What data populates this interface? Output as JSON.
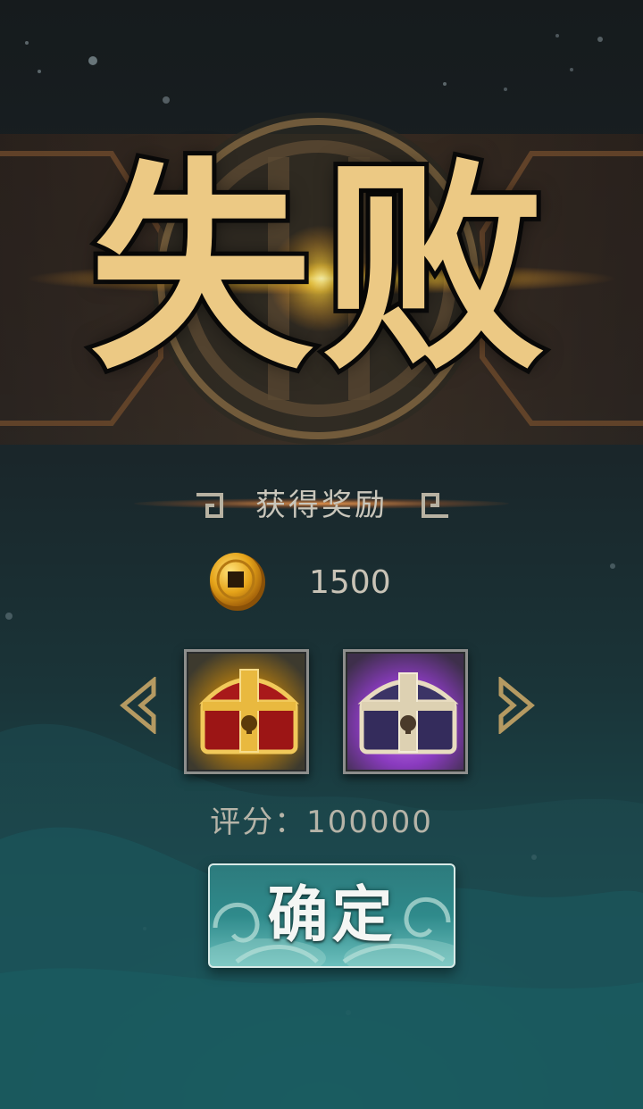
{
  "result": {
    "title": "失败"
  },
  "rewards": {
    "header": "获得奖励",
    "coin_icon": "copper-coin-icon",
    "coin_amount": "1500",
    "items": [
      {
        "icon": "gold-red-treasure-chest-icon",
        "frame_color": "#d6a534"
      },
      {
        "icon": "purple-treasure-chest-icon",
        "frame_color": "#9b4fd0"
      }
    ],
    "prev_icon": "chevron-left-icon",
    "next_icon": "chevron-right-icon"
  },
  "score": {
    "text": "评分：100000"
  },
  "confirm": {
    "label": "确定"
  },
  "colors": {
    "title_gold": "#ecc984",
    "accent_teal": "#2f8a8b",
    "text_muted": "#c9c6bb"
  }
}
